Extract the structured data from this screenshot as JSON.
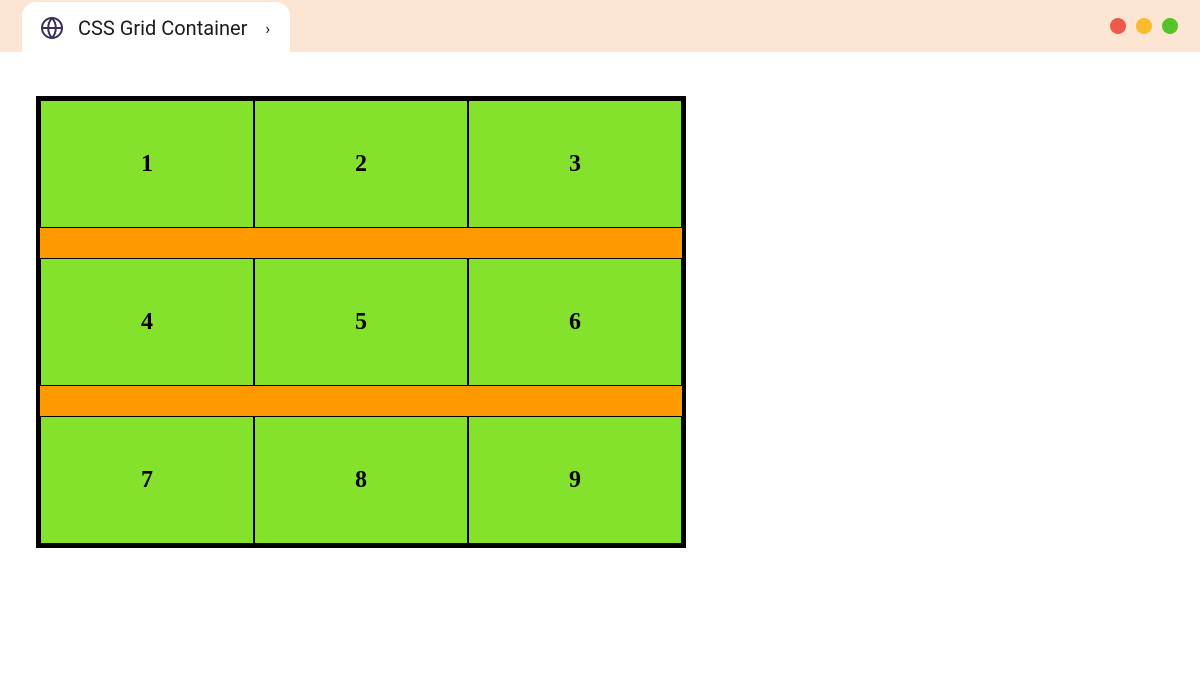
{
  "browser": {
    "tab_title": "CSS Grid Container",
    "chevron_glyph": "›"
  },
  "grid": {
    "cells": [
      "1",
      "2",
      "3",
      "4",
      "5",
      "6",
      "7",
      "8",
      "9"
    ]
  }
}
